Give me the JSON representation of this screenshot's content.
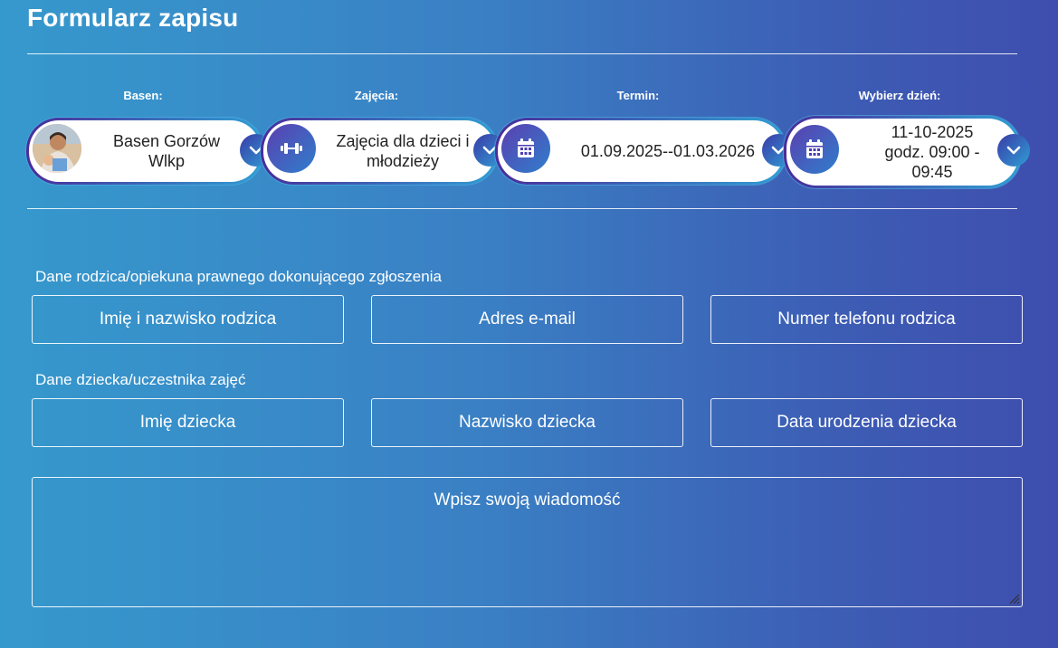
{
  "form": {
    "title": "Formularz zapisu"
  },
  "selectors": {
    "pool": {
      "label": "Basen:",
      "value": "Basen Gorzów Wlkp"
    },
    "classes": {
      "label": "Zajęcia:",
      "value": "Zajęcia dla dzieci i młodzieży",
      "icon": "dumbbell-icon"
    },
    "term": {
      "label": "Termin:",
      "value": "01.09.2025--01.03.2026",
      "icon": "calendar-icon"
    },
    "day": {
      "label": "Wybierz dzień:",
      "value": "11-10-2025 godz. 09:00 - 09:45",
      "icon": "calendar-icon"
    }
  },
  "parent_section": {
    "heading": "Dane rodzica/opiekuna prawnego dokonującego zgłoszenia",
    "name_placeholder": "Imię i nazwisko rodzica",
    "email_placeholder": "Adres e-mail",
    "phone_placeholder": "Numer telefonu rodzica"
  },
  "child_section": {
    "heading": "Dane dziecka/uczestnika zajęć",
    "firstname_placeholder": "Imię dziecka",
    "lastname_placeholder": "Nazwisko dziecka",
    "birthdate_placeholder": "Data urodzenia dziecka"
  },
  "message": {
    "placeholder": "Wpisz swoją wiadomość"
  },
  "colors": {
    "bg_start": "#3699cd",
    "bg_end": "#3e4eae",
    "accent": "#4a2d9a"
  }
}
